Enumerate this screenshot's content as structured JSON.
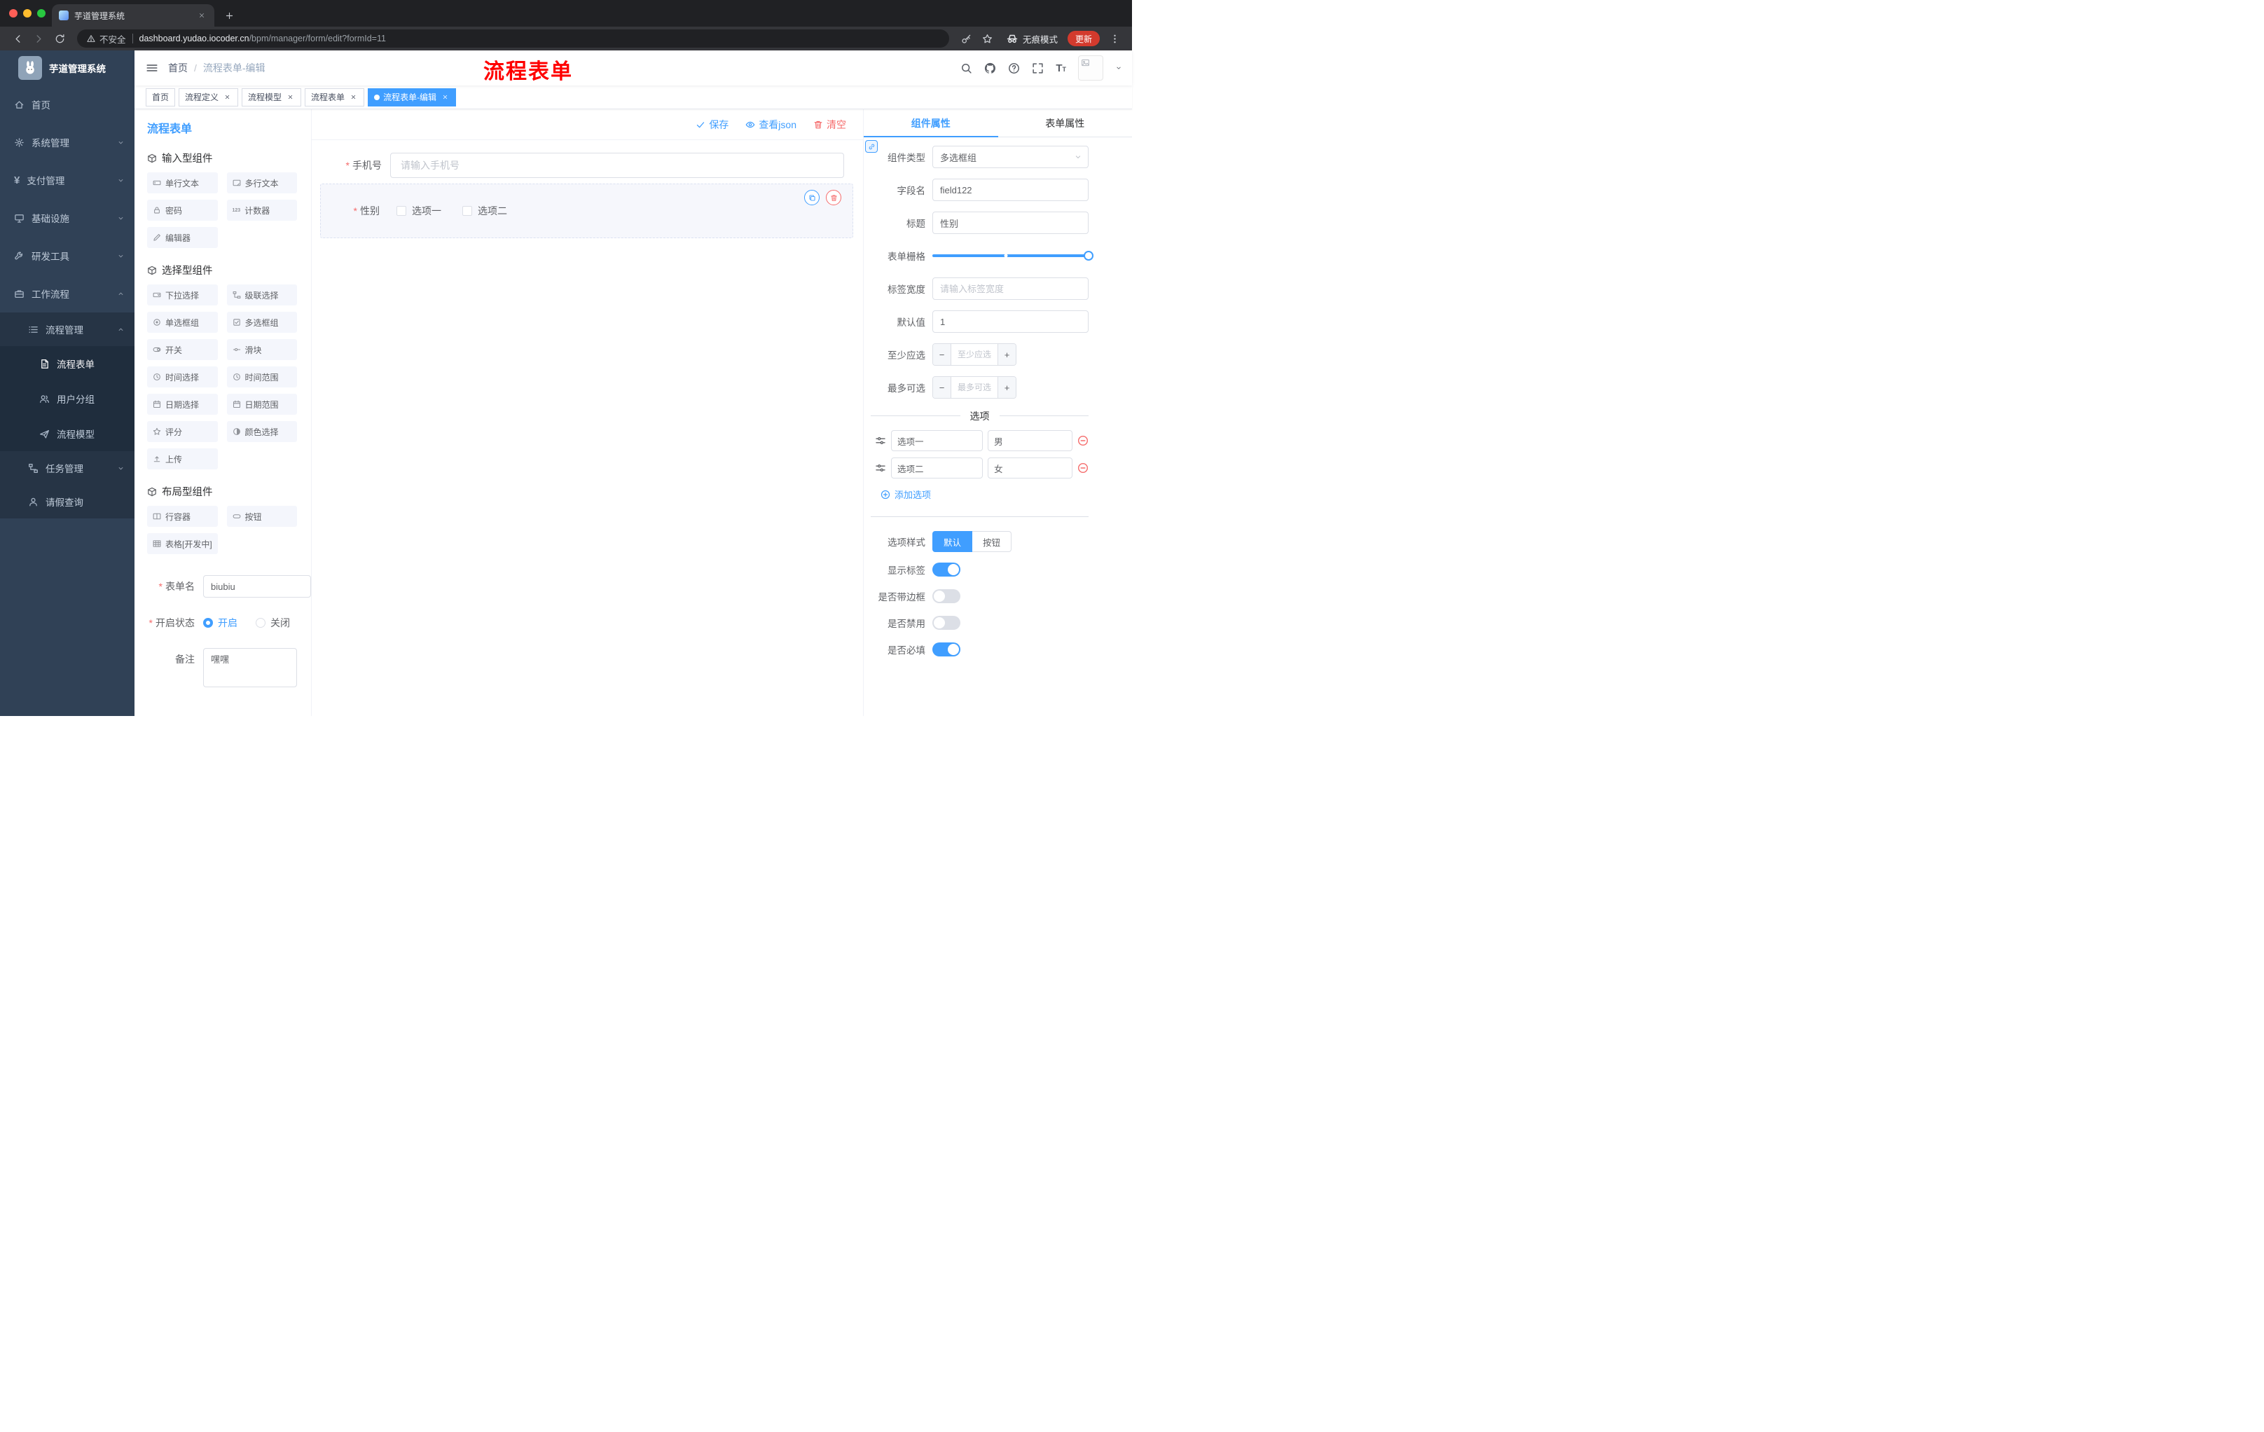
{
  "browser": {
    "tab_title": "芋道管理系统",
    "security_label": "不安全",
    "url_host": "dashboard.yudao.iocoder.cn",
    "url_path": "/bpm/manager/form/edit?formId=11",
    "incognito_label": "无痕模式",
    "update_label": "更新"
  },
  "sidebar": {
    "logo_title": "芋道管理系统",
    "items": [
      {
        "label": "首页",
        "icon": "home"
      },
      {
        "label": "系统管理",
        "icon": "gear"
      },
      {
        "label": "支付管理",
        "icon": "yen"
      },
      {
        "label": "基础设施",
        "icon": "server"
      },
      {
        "label": "研发工具",
        "icon": "wrench"
      },
      {
        "label": "工作流程",
        "icon": "briefcase"
      },
      {
        "label": "流程管理",
        "icon": "list"
      },
      {
        "label": "流程表单",
        "icon": "doc"
      },
      {
        "label": "用户分组",
        "icon": "users"
      },
      {
        "label": "流程模型",
        "icon": "send"
      },
      {
        "label": "任务管理",
        "icon": "flow"
      },
      {
        "label": "请假查询",
        "icon": "person"
      }
    ]
  },
  "navbar": {
    "breadcrumb_home": "首页",
    "breadcrumb_current": "流程表单-编辑",
    "watermark": "流程表单"
  },
  "tags": [
    {
      "label": "首页"
    },
    {
      "label": "流程定义"
    },
    {
      "label": "流程模型"
    },
    {
      "label": "流程表单"
    },
    {
      "label": "流程表单-编辑"
    }
  ],
  "palette": {
    "title": "流程表单",
    "sections": [
      {
        "title": "输入型组件",
        "chips": [
          {
            "label": "单行文本",
            "icon": "input"
          },
          {
            "label": "多行文本",
            "icon": "textarea"
          },
          {
            "label": "密码",
            "icon": "lock"
          },
          {
            "label": "计数器",
            "icon": "counter"
          },
          {
            "label": "编辑器",
            "icon": "editor"
          }
        ]
      },
      {
        "title": "选择型组件",
        "chips": [
          {
            "label": "下拉选择",
            "icon": "select"
          },
          {
            "label": "级联选择",
            "icon": "cascade"
          },
          {
            "label": "单选框组",
            "icon": "radio"
          },
          {
            "label": "多选框组",
            "icon": "checkbox"
          },
          {
            "label": "开关",
            "icon": "switch"
          },
          {
            "label": "滑块",
            "icon": "slider"
          },
          {
            "label": "时间选择",
            "icon": "time"
          },
          {
            "label": "时间范围",
            "icon": "time"
          },
          {
            "label": "日期选择",
            "icon": "date"
          },
          {
            "label": "日期范围",
            "icon": "date"
          },
          {
            "label": "评分",
            "icon": "star"
          },
          {
            "label": "颜色选择",
            "icon": "color"
          },
          {
            "label": "上传",
            "icon": "upload"
          }
        ]
      },
      {
        "title": "布局型组件",
        "chips": [
          {
            "label": "行容器",
            "icon": "row"
          },
          {
            "label": "按钮",
            "icon": "button"
          },
          {
            "label": "表格[开发中]",
            "icon": "table"
          }
        ]
      }
    ],
    "form": {
      "name_label": "表单名",
      "name_value": "biubiu",
      "status_label": "开启状态",
      "status_on": "开启",
      "status_off": "关闭",
      "remark_label": "备注",
      "remark_value": "嘿嘿"
    }
  },
  "canvas": {
    "save_label": "保存",
    "view_json_label": "查看json",
    "clear_label": "清空",
    "phone": {
      "label": "手机号",
      "placeholder": "请输入手机号"
    },
    "gender": {
      "label": "性别",
      "option1": "选项一",
      "option2": "选项二"
    }
  },
  "props": {
    "tab_component": "组件属性",
    "tab_form": "表单属性",
    "rows": {
      "component_type": {
        "label": "组件类型",
        "value": "多选框组"
      },
      "field_name": {
        "label": "字段名",
        "value": "field122"
      },
      "title": {
        "label": "标题",
        "value": "性别"
      },
      "grid": {
        "label": "表单栅格"
      },
      "label_width": {
        "label": "标签宽度",
        "placeholder": "请输入标签宽度"
      },
      "default": {
        "label": "默认值",
        "value": "1"
      },
      "min": {
        "label": "至少应选",
        "placeholder": "至少应选"
      },
      "max": {
        "label": "最多可选",
        "placeholder": "最多可选"
      }
    },
    "options_title": "选项",
    "options": [
      {
        "name": "选项一",
        "value": "男"
      },
      {
        "name": "选项二",
        "value": "女"
      }
    ],
    "add_option_label": "添加选项",
    "style": {
      "label": "选项样式",
      "default": "默认",
      "button": "按钮"
    },
    "switches": [
      {
        "label": "显示标签",
        "on": true
      },
      {
        "label": "是否带边框",
        "on": false
      },
      {
        "label": "是否禁用",
        "on": false
      },
      {
        "label": "是否必填",
        "on": true
      }
    ]
  },
  "colors": {
    "accent": "#409EFF",
    "danger": "#F56C6C",
    "watermark": "#FF0000"
  }
}
